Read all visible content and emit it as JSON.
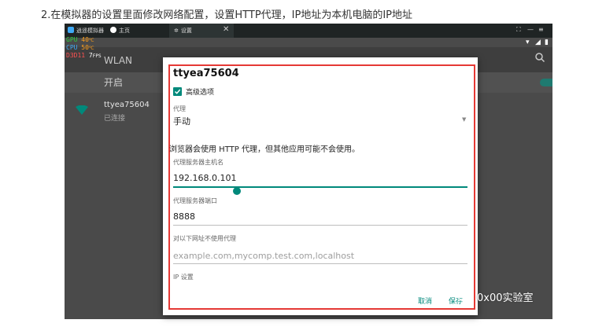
{
  "caption": "2.在模拟器的设置里面修改网络配置，设置HTTP代理，IP地址为本机电脑的IP地址",
  "titlebar": {
    "app_name": "逍遥模拟器",
    "home_tab": "主页",
    "settings_tab": "设置",
    "close_glyph": "✕"
  },
  "overlay": {
    "gpu_label": "GPU",
    "gpu_temp": "40",
    "gpu_unit": "℃",
    "cpu_label": "CPU",
    "cpu_temp": "50",
    "cpu_unit": "℃",
    "d3d_label": "D3D11",
    "fps": "7",
    "fps_unit": "FPS"
  },
  "settings_page": {
    "title": "WLAN",
    "switch_label": "开启",
    "network_ssid": "ttyea75604",
    "network_status": "已连接"
  },
  "dialog": {
    "title": "ttyea75604",
    "advanced_label": "高级选项",
    "advanced_checked": true,
    "proxy_label": "代理",
    "proxy_value": "手动",
    "proxy_warning": "浏览器会使用 HTTP 代理，但其他应用可能不会使用。",
    "host_label": "代理服务器主机名",
    "host_value": "192.168.0.101",
    "port_label": "代理服务器端口",
    "port_value": "8888",
    "bypass_label": "对以下网址不使用代理",
    "bypass_placeholder": "example.com,mycomp.test.com,localhost",
    "ip_settings_label": "IP 设置",
    "cancel_button": "取消",
    "save_button": "保存"
  },
  "watermark": "0x00实验室",
  "colors": {
    "accent": "#00897b",
    "highlight_box": "#e53935",
    "emulator_bg": "#4a4a4a"
  }
}
